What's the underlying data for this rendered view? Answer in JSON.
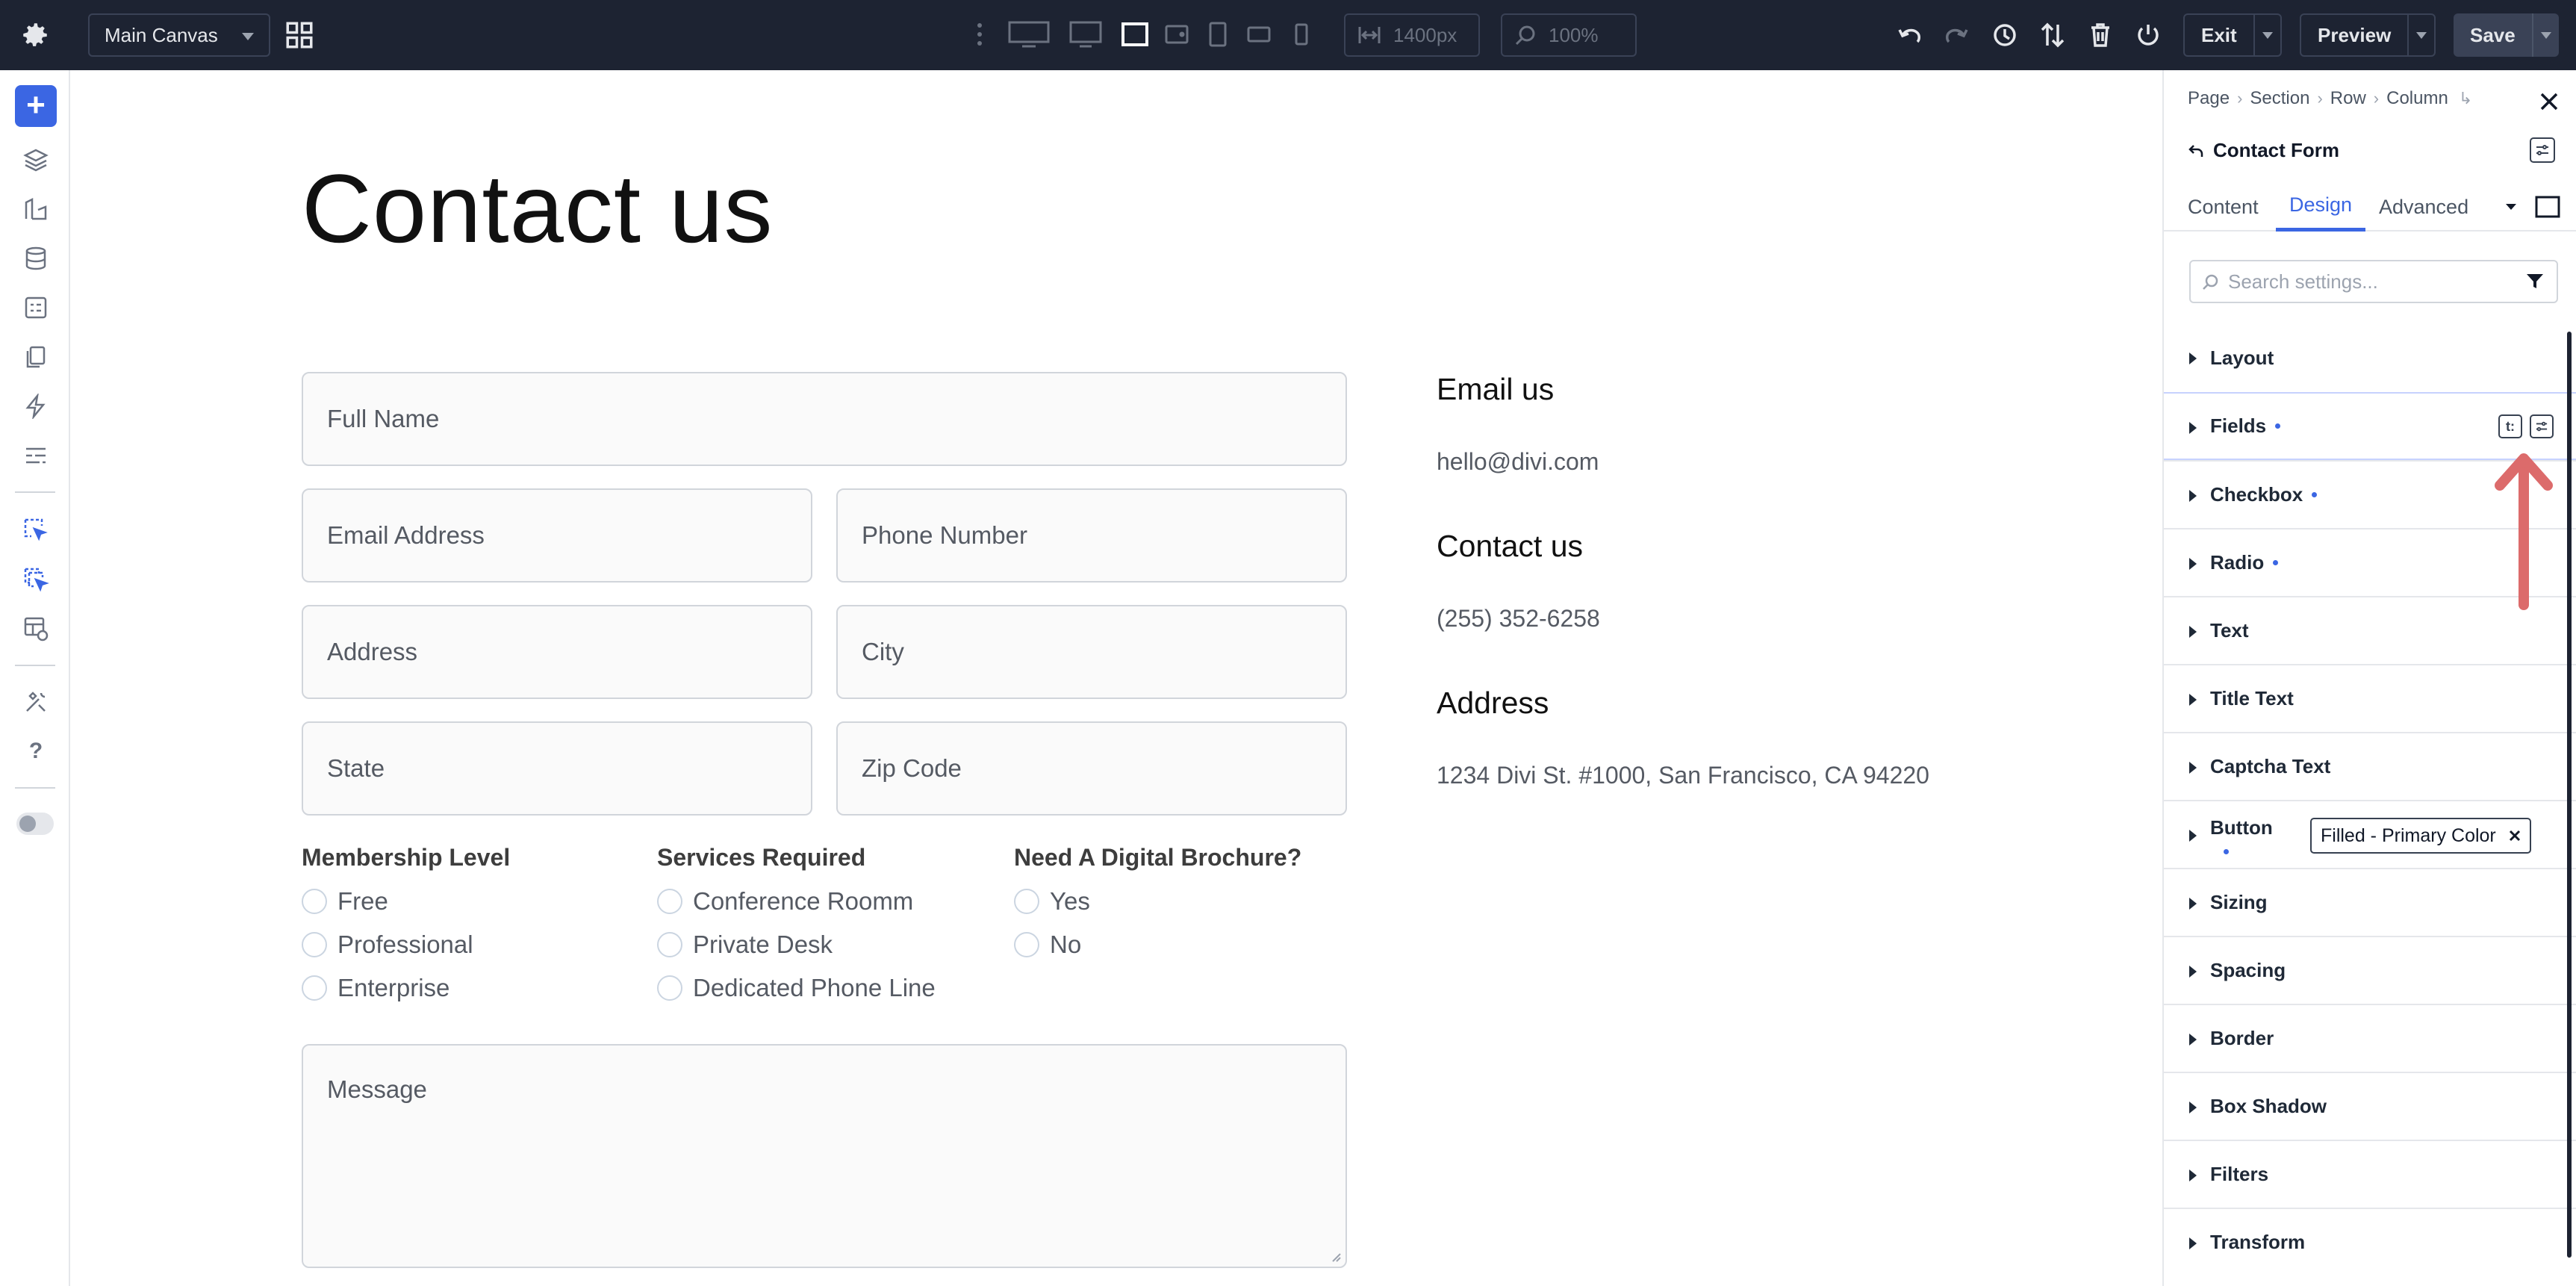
{
  "topbar": {
    "canvas_select": "Main Canvas",
    "width_value": "1400px",
    "zoom_value": "100%",
    "exit_label": "Exit",
    "preview_label": "Preview",
    "save_label": "Save",
    "colors": {
      "bg": "#1d2332",
      "save_bg": "#3a4256"
    }
  },
  "left_rail": {
    "icons": [
      "add-icon",
      "layers-icon",
      "library-icon",
      "database-icon",
      "form-icon",
      "pages-icon",
      "bolt-icon",
      "rows-icon",
      "click-select-icon",
      "multi-select-icon",
      "table-settings-icon",
      "wrench-icon",
      "help-icon",
      "theme-toggle"
    ]
  },
  "canvas": {
    "title": "Contact us",
    "fields": {
      "full_name": "Full Name",
      "email": "Email Address",
      "phone": "Phone Number",
      "address": "Address",
      "city": "City",
      "state": "State",
      "zip": "Zip Code",
      "message": "Message"
    },
    "groups": [
      {
        "title": "Membership Level",
        "options": [
          "Free",
          "Professional",
          "Enterprise"
        ]
      },
      {
        "title": "Services Required",
        "options": [
          "Conference Roomm",
          "Private Desk",
          "Dedicated Phone Line"
        ]
      },
      {
        "title": "Need A Digital Brochure?",
        "options": [
          "Yes",
          "No"
        ]
      }
    ],
    "info": {
      "email_heading": "Email us",
      "email_value": "hello@divi.com",
      "contact_heading": "Contact us",
      "contact_value": "(255) 352-6258",
      "address_heading": "Address",
      "address_value": "1234 Divi St. #1000, San Francisco, CA 94220"
    }
  },
  "panel": {
    "breadcrumb": [
      "Page",
      "Section",
      "Row",
      "Column"
    ],
    "module_name": "Contact Form",
    "tabs": [
      "Content",
      "Design",
      "Advanced"
    ],
    "active_tab": "Design",
    "search_placeholder": "Search settings...",
    "sections": [
      "Layout",
      "Fields",
      "Checkbox",
      "Radio",
      "Text",
      "Title Text",
      "Captcha Text",
      "Button",
      "Sizing",
      "Spacing",
      "Border",
      "Box Shadow",
      "Filters",
      "Transform"
    ],
    "button_preset": "Filled - Primary Color",
    "accent": "#3b66e3"
  }
}
